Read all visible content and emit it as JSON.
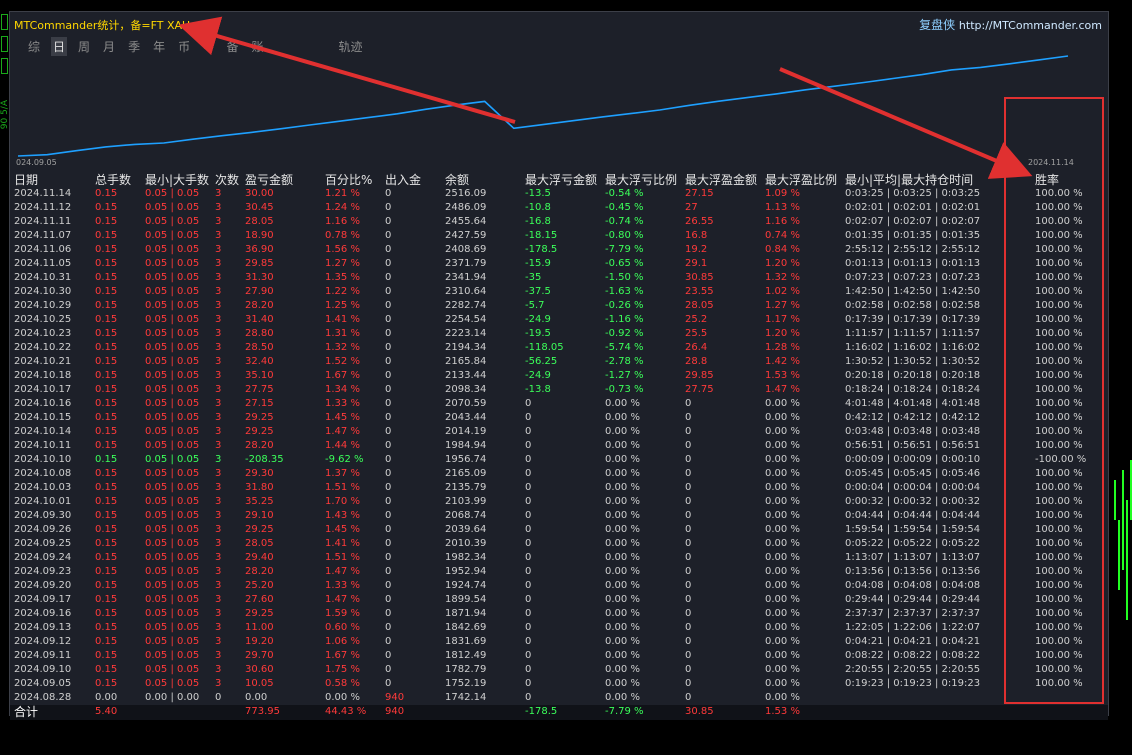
{
  "app": {
    "title": "MTCommander统计，备=FT XAU",
    "brand": "复盘侠",
    "brand_url": "http://MTCommander.com"
  },
  "left_strip": {
    "label": "90 5/A"
  },
  "tabs": [
    {
      "label": "综",
      "active": false
    },
    {
      "label": "日",
      "active": true
    },
    {
      "label": "周",
      "active": false
    },
    {
      "label": "月",
      "active": false
    },
    {
      "label": "季",
      "active": false
    },
    {
      "label": "年",
      "active": false
    },
    {
      "label": "币",
      "active": false
    },
    {
      "label": "M",
      "active": false
    },
    {
      "label": "备",
      "active": false
    },
    {
      "label": "账",
      "active": false
    },
    {
      "label": "轨迹",
      "active": false
    }
  ],
  "chart_data": {
    "type": "line",
    "x_start_label": "024.09.05",
    "x_end_label": "2024.11.14",
    "line_color": "#1ea0ff",
    "points": [
      [
        0,
        1742.14
      ],
      [
        1,
        1752.19
      ],
      [
        2,
        1782.79
      ],
      [
        3,
        1812.49
      ],
      [
        4,
        1831.69
      ],
      [
        5,
        1842.69
      ],
      [
        6,
        1871.94
      ],
      [
        7,
        1899.54
      ],
      [
        8,
        1924.74
      ],
      [
        9,
        1952.94
      ],
      [
        10,
        1982.34
      ],
      [
        11,
        2010.39
      ],
      [
        12,
        2039.64
      ],
      [
        13,
        2068.74
      ],
      [
        14,
        2103.99
      ],
      [
        15,
        2135.79
      ],
      [
        16,
        2165.09
      ],
      [
        17,
        1956.74
      ],
      [
        18,
        1984.94
      ],
      [
        19,
        2014.19
      ],
      [
        20,
        2043.44
      ],
      [
        21,
        2070.59
      ],
      [
        22,
        2098.34
      ],
      [
        23,
        2133.44
      ],
      [
        24,
        2165.84
      ],
      [
        25,
        2194.34
      ],
      [
        26,
        2223.14
      ],
      [
        27,
        2254.54
      ],
      [
        28,
        2282.74
      ],
      [
        29,
        2310.64
      ],
      [
        30,
        2341.94
      ],
      [
        31,
        2371.79
      ],
      [
        32,
        2408.69
      ],
      [
        33,
        2427.59
      ],
      [
        34,
        2455.64
      ],
      [
        35,
        2486.09
      ],
      [
        36,
        2516.09
      ]
    ]
  },
  "table": {
    "headers": [
      "日期",
      "总手数",
      "最小|大手数",
      "次数",
      "盈亏金额",
      "百分比%",
      "出入金",
      "余额",
      "最大浮亏金额",
      "最大浮亏比例",
      "最大浮盈金额",
      "最大浮盈比例",
      "最小|平均|最大持仓时间",
      "胜率"
    ],
    "rows": [
      {
        "date": "2024.11.14",
        "lots": "0.15",
        "minmax": "0.05 | 0.05",
        "count": "3",
        "pnl": "30.00",
        "pct": "1.21 %",
        "flow": "0",
        "balance": "2516.09",
        "fl_amt": "-13.5",
        "fl_pct": "-0.54 %",
        "fp_amt": "27.15",
        "fp_pct": "1.09 %",
        "hold": "0:03:25 | 0:03:25 | 0:03:25",
        "win": "100.00 %",
        "tone": "red"
      },
      {
        "date": "2024.11.12",
        "lots": "0.15",
        "minmax": "0.05 | 0.05",
        "count": "3",
        "pnl": "30.45",
        "pct": "1.24 %",
        "flow": "0",
        "balance": "2486.09",
        "fl_amt": "-10.8",
        "fl_pct": "-0.45 %",
        "fp_amt": "27",
        "fp_pct": "1.13 %",
        "hold": "0:02:01 | 0:02:01 | 0:02:01",
        "win": "100.00 %",
        "tone": "red"
      },
      {
        "date": "2024.11.11",
        "lots": "0.15",
        "minmax": "0.05 | 0.05",
        "count": "3",
        "pnl": "28.05",
        "pct": "1.16 %",
        "flow": "0",
        "balance": "2455.64",
        "fl_amt": "-16.8",
        "fl_pct": "-0.74 %",
        "fp_amt": "26.55",
        "fp_pct": "1.16 %",
        "hold": "0:02:07 | 0:02:07 | 0:02:07",
        "win": "100.00 %",
        "tone": "red"
      },
      {
        "date": "2024.11.07",
        "lots": "0.15",
        "minmax": "0.05 | 0.05",
        "count": "3",
        "pnl": "18.90",
        "pct": "0.78 %",
        "flow": "0",
        "balance": "2427.59",
        "fl_amt": "-18.15",
        "fl_pct": "-0.80 %",
        "fp_amt": "16.8",
        "fp_pct": "0.74 %",
        "hold": "0:01:35 | 0:01:35 | 0:01:35",
        "win": "100.00 %",
        "tone": "red"
      },
      {
        "date": "2024.11.06",
        "lots": "0.15",
        "minmax": "0.05 | 0.05",
        "count": "3",
        "pnl": "36.90",
        "pct": "1.56 %",
        "flow": "0",
        "balance": "2408.69",
        "fl_amt": "-178.5",
        "fl_pct": "-7.79 %",
        "fp_amt": "19.2",
        "fp_pct": "0.84 %",
        "hold": "2:55:12 | 2:55:12 | 2:55:12",
        "win": "100.00 %",
        "tone": "red"
      },
      {
        "date": "2024.11.05",
        "lots": "0.15",
        "minmax": "0.05 | 0.05",
        "count": "3",
        "pnl": "29.85",
        "pct": "1.27 %",
        "flow": "0",
        "balance": "2371.79",
        "fl_amt": "-15.9",
        "fl_pct": "-0.65 %",
        "fp_amt": "29.1",
        "fp_pct": "1.20 %",
        "hold": "0:01:13 | 0:01:13 | 0:01:13",
        "win": "100.00 %",
        "tone": "red"
      },
      {
        "date": "2024.10.31",
        "lots": "0.15",
        "minmax": "0.05 | 0.05",
        "count": "3",
        "pnl": "31.30",
        "pct": "1.35 %",
        "flow": "0",
        "balance": "2341.94",
        "fl_amt": "-35",
        "fl_pct": "-1.50 %",
        "fp_amt": "30.85",
        "fp_pct": "1.32 %",
        "hold": "0:07:23 | 0:07:23 | 0:07:23",
        "win": "100.00 %",
        "tone": "red"
      },
      {
        "date": "2024.10.30",
        "lots": "0.15",
        "minmax": "0.05 | 0.05",
        "count": "3",
        "pnl": "27.90",
        "pct": "1.22 %",
        "flow": "0",
        "balance": "2310.64",
        "fl_amt": "-37.5",
        "fl_pct": "-1.63 %",
        "fp_amt": "23.55",
        "fp_pct": "1.02 %",
        "hold": "1:42:50 | 1:42:50 | 1:42:50",
        "win": "100.00 %",
        "tone": "red"
      },
      {
        "date": "2024.10.29",
        "lots": "0.15",
        "minmax": "0.05 | 0.05",
        "count": "3",
        "pnl": "28.20",
        "pct": "1.25 %",
        "flow": "0",
        "balance": "2282.74",
        "fl_amt": "-5.7",
        "fl_pct": "-0.26 %",
        "fp_amt": "28.05",
        "fp_pct": "1.27 %",
        "hold": "0:02:58 | 0:02:58 | 0:02:58",
        "win": "100.00 %",
        "tone": "red"
      },
      {
        "date": "2024.10.25",
        "lots": "0.15",
        "minmax": "0.05 | 0.05",
        "count": "3",
        "pnl": "31.40",
        "pct": "1.41 %",
        "flow": "0",
        "balance": "2254.54",
        "fl_amt": "-24.9",
        "fl_pct": "-1.16 %",
        "fp_amt": "25.2",
        "fp_pct": "1.17 %",
        "hold": "0:17:39 | 0:17:39 | 0:17:39",
        "win": "100.00 %",
        "tone": "red"
      },
      {
        "date": "2024.10.23",
        "lots": "0.15",
        "minmax": "0.05 | 0.05",
        "count": "3",
        "pnl": "28.80",
        "pct": "1.31 %",
        "flow": "0",
        "balance": "2223.14",
        "fl_amt": "-19.5",
        "fl_pct": "-0.92 %",
        "fp_amt": "25.5",
        "fp_pct": "1.20 %",
        "hold": "1:11:57 | 1:11:57 | 1:11:57",
        "win": "100.00 %",
        "tone": "red"
      },
      {
        "date": "2024.10.22",
        "lots": "0.15",
        "minmax": "0.05 | 0.05",
        "count": "3",
        "pnl": "28.50",
        "pct": "1.32 %",
        "flow": "0",
        "balance": "2194.34",
        "fl_amt": "-118.05",
        "fl_pct": "-5.74 %",
        "fp_amt": "26.4",
        "fp_pct": "1.28 %",
        "hold": "1:16:02 | 1:16:02 | 1:16:02",
        "win": "100.00 %",
        "tone": "red"
      },
      {
        "date": "2024.10.21",
        "lots": "0.15",
        "minmax": "0.05 | 0.05",
        "count": "3",
        "pnl": "32.40",
        "pct": "1.52 %",
        "flow": "0",
        "balance": "2165.84",
        "fl_amt": "-56.25",
        "fl_pct": "-2.78 %",
        "fp_amt": "28.8",
        "fp_pct": "1.42 %",
        "hold": "1:30:52 | 1:30:52 | 1:30:52",
        "win": "100.00 %",
        "tone": "red"
      },
      {
        "date": "2024.10.18",
        "lots": "0.15",
        "minmax": "0.05 | 0.05",
        "count": "3",
        "pnl": "35.10",
        "pct": "1.67 %",
        "flow": "0",
        "balance": "2133.44",
        "fl_amt": "-24.9",
        "fl_pct": "-1.27 %",
        "fp_amt": "29.85",
        "fp_pct": "1.53 %",
        "hold": "0:20:18 | 0:20:18 | 0:20:18",
        "win": "100.00 %",
        "tone": "red"
      },
      {
        "date": "2024.10.17",
        "lots": "0.15",
        "minmax": "0.05 | 0.05",
        "count": "3",
        "pnl": "27.75",
        "pct": "1.34 %",
        "flow": "0",
        "balance": "2098.34",
        "fl_amt": "-13.8",
        "fl_pct": "-0.73 %",
        "fp_amt": "27.75",
        "fp_pct": "1.47 %",
        "hold": "0:18:24 | 0:18:24 | 0:18:24",
        "win": "100.00 %",
        "tone": "red"
      },
      {
        "date": "2024.10.16",
        "lots": "0.15",
        "minmax": "0.05 | 0.05",
        "count": "3",
        "pnl": "27.15",
        "pct": "1.33 %",
        "flow": "0",
        "balance": "2070.59",
        "fl_amt": "0",
        "fl_pct": "0.00 %",
        "fp_amt": "0",
        "fp_pct": "0.00 %",
        "hold": "4:01:48 | 4:01:48 | 4:01:48",
        "win": "100.00 %",
        "tone": "red"
      },
      {
        "date": "2024.10.15",
        "lots": "0.15",
        "minmax": "0.05 | 0.05",
        "count": "3",
        "pnl": "29.25",
        "pct": "1.45 %",
        "flow": "0",
        "balance": "2043.44",
        "fl_amt": "0",
        "fl_pct": "0.00 %",
        "fp_amt": "0",
        "fp_pct": "0.00 %",
        "hold": "0:42:12 | 0:42:12 | 0:42:12",
        "win": "100.00 %",
        "tone": "red"
      },
      {
        "date": "2024.10.14",
        "lots": "0.15",
        "minmax": "0.05 | 0.05",
        "count": "3",
        "pnl": "29.25",
        "pct": "1.47 %",
        "flow": "0",
        "balance": "2014.19",
        "fl_amt": "0",
        "fl_pct": "0.00 %",
        "fp_amt": "0",
        "fp_pct": "0.00 %",
        "hold": "0:03:48 | 0:03:48 | 0:03:48",
        "win": "100.00 %",
        "tone": "red"
      },
      {
        "date": "2024.10.11",
        "lots": "0.15",
        "minmax": "0.05 | 0.05",
        "count": "3",
        "pnl": "28.20",
        "pct": "1.44 %",
        "flow": "0",
        "balance": "1984.94",
        "fl_amt": "0",
        "fl_pct": "0.00 %",
        "fp_amt": "0",
        "fp_pct": "0.00 %",
        "hold": "0:56:51 | 0:56:51 | 0:56:51",
        "win": "100.00 %",
        "tone": "red"
      },
      {
        "date": "2024.10.10",
        "lots": "0.15",
        "minmax": "0.05 | 0.05",
        "count": "3",
        "pnl": "-208.35",
        "pct": "-9.62 %",
        "flow": "0",
        "balance": "1956.74",
        "fl_amt": "0",
        "fl_pct": "0.00 %",
        "fp_amt": "0",
        "fp_pct": "0.00 %",
        "hold": "0:00:09 | 0:00:09 | 0:00:10",
        "win": "-100.00 %",
        "tone": "green"
      },
      {
        "date": "2024.10.08",
        "lots": "0.15",
        "minmax": "0.05 | 0.05",
        "count": "3",
        "pnl": "29.30",
        "pct": "1.37 %",
        "flow": "0",
        "balance": "2165.09",
        "fl_amt": "0",
        "fl_pct": "0.00 %",
        "fp_amt": "0",
        "fp_pct": "0.00 %",
        "hold": "0:05:45 | 0:05:45 | 0:05:46",
        "win": "100.00 %",
        "tone": "red"
      },
      {
        "date": "2024.10.03",
        "lots": "0.15",
        "minmax": "0.05 | 0.05",
        "count": "3",
        "pnl": "31.80",
        "pct": "1.51 %",
        "flow": "0",
        "balance": "2135.79",
        "fl_amt": "0",
        "fl_pct": "0.00 %",
        "fp_amt": "0",
        "fp_pct": "0.00 %",
        "hold": "0:00:04 | 0:00:04 | 0:00:04",
        "win": "100.00 %",
        "tone": "red"
      },
      {
        "date": "2024.10.01",
        "lots": "0.15",
        "minmax": "0.05 | 0.05",
        "count": "3",
        "pnl": "35.25",
        "pct": "1.70 %",
        "flow": "0",
        "balance": "2103.99",
        "fl_amt": "0",
        "fl_pct": "0.00 %",
        "fp_amt": "0",
        "fp_pct": "0.00 %",
        "hold": "0:00:32 | 0:00:32 | 0:00:32",
        "win": "100.00 %",
        "tone": "red"
      },
      {
        "date": "2024.09.30",
        "lots": "0.15",
        "minmax": "0.05 | 0.05",
        "count": "3",
        "pnl": "29.10",
        "pct": "1.43 %",
        "flow": "0",
        "balance": "2068.74",
        "fl_amt": "0",
        "fl_pct": "0.00 %",
        "fp_amt": "0",
        "fp_pct": "0.00 %",
        "hold": "0:04:44 | 0:04:44 | 0:04:44",
        "win": "100.00 %",
        "tone": "red"
      },
      {
        "date": "2024.09.26",
        "lots": "0.15",
        "minmax": "0.05 | 0.05",
        "count": "3",
        "pnl": "29.25",
        "pct": "1.45 %",
        "flow": "0",
        "balance": "2039.64",
        "fl_amt": "0",
        "fl_pct": "0.00 %",
        "fp_amt": "0",
        "fp_pct": "0.00 %",
        "hold": "1:59:54 | 1:59:54 | 1:59:54",
        "win": "100.00 %",
        "tone": "red"
      },
      {
        "date": "2024.09.25",
        "lots": "0.15",
        "minmax": "0.05 | 0.05",
        "count": "3",
        "pnl": "28.05",
        "pct": "1.41 %",
        "flow": "0",
        "balance": "2010.39",
        "fl_amt": "0",
        "fl_pct": "0.00 %",
        "fp_amt": "0",
        "fp_pct": "0.00 %",
        "hold": "0:05:22 | 0:05:22 | 0:05:22",
        "win": "100.00 %",
        "tone": "red"
      },
      {
        "date": "2024.09.24",
        "lots": "0.15",
        "minmax": "0.05 | 0.05",
        "count": "3",
        "pnl": "29.40",
        "pct": "1.51 %",
        "flow": "0",
        "balance": "1982.34",
        "fl_amt": "0",
        "fl_pct": "0.00 %",
        "fp_amt": "0",
        "fp_pct": "0.00 %",
        "hold": "1:13:07 | 1:13:07 | 1:13:07",
        "win": "100.00 %",
        "tone": "red"
      },
      {
        "date": "2024.09.23",
        "lots": "0.15",
        "minmax": "0.05 | 0.05",
        "count": "3",
        "pnl": "28.20",
        "pct": "1.47 %",
        "flow": "0",
        "balance": "1952.94",
        "fl_amt": "0",
        "fl_pct": "0.00 %",
        "fp_amt": "0",
        "fp_pct": "0.00 %",
        "hold": "0:13:56 | 0:13:56 | 0:13:56",
        "win": "100.00 %",
        "tone": "red"
      },
      {
        "date": "2024.09.20",
        "lots": "0.15",
        "minmax": "0.05 | 0.05",
        "count": "3",
        "pnl": "25.20",
        "pct": "1.33 %",
        "flow": "0",
        "balance": "1924.74",
        "fl_amt": "0",
        "fl_pct": "0.00 %",
        "fp_amt": "0",
        "fp_pct": "0.00 %",
        "hold": "0:04:08 | 0:04:08 | 0:04:08",
        "win": "100.00 %",
        "tone": "red"
      },
      {
        "date": "2024.09.17",
        "lots": "0.15",
        "minmax": "0.05 | 0.05",
        "count": "3",
        "pnl": "27.60",
        "pct": "1.47 %",
        "flow": "0",
        "balance": "1899.54",
        "fl_amt": "0",
        "fl_pct": "0.00 %",
        "fp_amt": "0",
        "fp_pct": "0.00 %",
        "hold": "0:29:44 | 0:29:44 | 0:29:44",
        "win": "100.00 %",
        "tone": "red"
      },
      {
        "date": "2024.09.16",
        "lots": "0.15",
        "minmax": "0.05 | 0.05",
        "count": "3",
        "pnl": "29.25",
        "pct": "1.59 %",
        "flow": "0",
        "balance": "1871.94",
        "fl_amt": "0",
        "fl_pct": "0.00 %",
        "fp_amt": "0",
        "fp_pct": "0.00 %",
        "hold": "2:37:37 | 2:37:37 | 2:37:37",
        "win": "100.00 %",
        "tone": "red"
      },
      {
        "date": "2024.09.13",
        "lots": "0.15",
        "minmax": "0.05 | 0.05",
        "count": "3",
        "pnl": "11.00",
        "pct": "0.60 %",
        "flow": "0",
        "balance": "1842.69",
        "fl_amt": "0",
        "fl_pct": "0.00 %",
        "fp_amt": "0",
        "fp_pct": "0.00 %",
        "hold": "1:22:05 | 1:22:06 | 1:22:07",
        "win": "100.00 %",
        "tone": "red"
      },
      {
        "date": "2024.09.12",
        "lots": "0.15",
        "minmax": "0.05 | 0.05",
        "count": "3",
        "pnl": "19.20",
        "pct": "1.06 %",
        "flow": "0",
        "balance": "1831.69",
        "fl_amt": "0",
        "fl_pct": "0.00 %",
        "fp_amt": "0",
        "fp_pct": "0.00 %",
        "hold": "0:04:21 | 0:04:21 | 0:04:21",
        "win": "100.00 %",
        "tone": "red"
      },
      {
        "date": "2024.09.11",
        "lots": "0.15",
        "minmax": "0.05 | 0.05",
        "count": "3",
        "pnl": "29.70",
        "pct": "1.67 %",
        "flow": "0",
        "balance": "1812.49",
        "fl_amt": "0",
        "fl_pct": "0.00 %",
        "fp_amt": "0",
        "fp_pct": "0.00 %",
        "hold": "0:08:22 | 0:08:22 | 0:08:22",
        "win": "100.00 %",
        "tone": "red"
      },
      {
        "date": "2024.09.10",
        "lots": "0.15",
        "minmax": "0.05 | 0.05",
        "count": "3",
        "pnl": "30.60",
        "pct": "1.75 %",
        "flow": "0",
        "balance": "1782.79",
        "fl_amt": "0",
        "fl_pct": "0.00 %",
        "fp_amt": "0",
        "fp_pct": "0.00 %",
        "hold": "2:20:55 | 2:20:55 | 2:20:55",
        "win": "100.00 %",
        "tone": "red"
      },
      {
        "date": "2024.09.05",
        "lots": "0.15",
        "minmax": "0.05 | 0.05",
        "count": "3",
        "pnl": "10.05",
        "pct": "0.58 %",
        "flow": "0",
        "balance": "1752.19",
        "fl_amt": "0",
        "fl_pct": "0.00 %",
        "fp_amt": "0",
        "fp_pct": "0.00 %",
        "hold": "0:19:23 | 0:19:23 | 0:19:23",
        "win": "100.00 %",
        "tone": "red"
      },
      {
        "date": "2024.08.28",
        "lots": "0.00",
        "minmax": "0.00 | 0.00",
        "count": "0",
        "pnl": "0.00",
        "pct": "0.00 %",
        "flow": "940",
        "balance": "1742.14",
        "fl_amt": "0",
        "fl_pct": "0.00 %",
        "fp_amt": "0",
        "fp_pct": "0.00 %",
        "hold": "",
        "win": "",
        "tone": "grey"
      }
    ],
    "total": {
      "label": "合计",
      "lots": "5.40",
      "pnl": "773.95",
      "pct": "44.43 %",
      "flow": "940",
      "fl_amt": "-178.5",
      "fl_pct": "-7.79 %",
      "fp_amt": "30.85",
      "fp_pct": "1.53 %"
    }
  },
  "colors": {
    "loss": "#ff3a3a",
    "gain": "#3bff5a",
    "annotation": "#e03030",
    "line": "#1ea0ff"
  }
}
